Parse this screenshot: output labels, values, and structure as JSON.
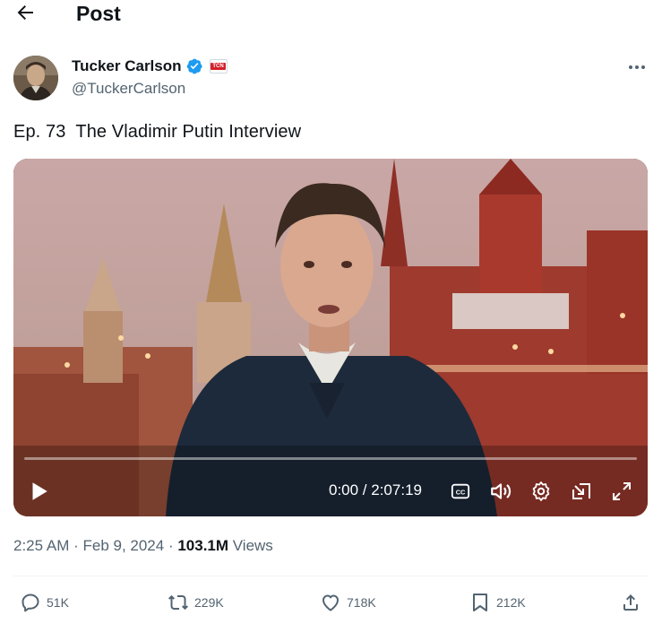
{
  "header": {
    "title": "Post"
  },
  "author": {
    "name": "Tucker Carlson",
    "handle": "@TuckerCarlson",
    "affiliate_badge": "TCN"
  },
  "post": {
    "text": "Ep. 73  The Vladimir Putin Interview"
  },
  "video": {
    "time": "0:00 / 2:07:19",
    "progress": 0
  },
  "meta": {
    "time": "2:25 AM",
    "sep1": " · ",
    "date": "Feb 9, 2024",
    "sep2": " · ",
    "views_count": "103.1M",
    "views_label": " Views"
  },
  "actions": {
    "replies": "51K",
    "reposts": "229K",
    "likes": "718K",
    "bookmarks": "212K"
  },
  "colors": {
    "verified": "#1d9bf0",
    "muted": "#536471",
    "text": "#0f1419"
  }
}
